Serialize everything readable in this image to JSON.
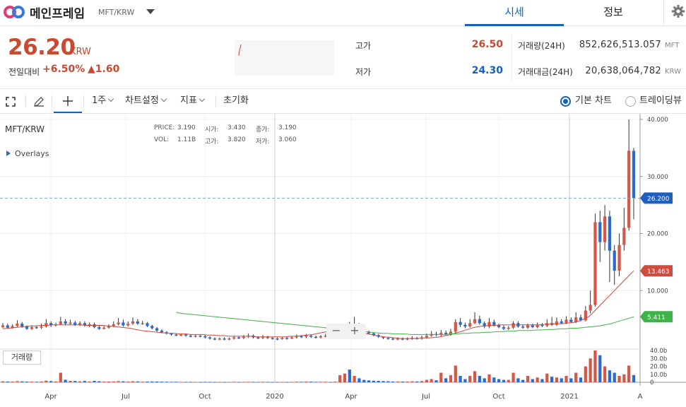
{
  "header": {
    "coin_name": "메인프레임",
    "coin_pair": "MFT/KRW",
    "tabs": [
      {
        "label": "시세",
        "active": true
      },
      {
        "label": "정보",
        "active": false
      }
    ]
  },
  "summary": {
    "price": "26.20",
    "unit": "KRW",
    "change_label": "전일대비",
    "change_pct": "+6.50%",
    "change_abs": "▲1.60",
    "high_label": "고가",
    "high_value": "26.50",
    "low_label": "저가",
    "low_value": "24.30",
    "volume_label": "거래량(24H)",
    "volume_value": "852,626,513.057",
    "volume_unit": "MFT",
    "amount_label": "거래대금(24H)",
    "amount_value": "20,638,064,782",
    "amount_unit": "KRW",
    "colors": {
      "up": "#c84a31",
      "down": "#1261c4"
    }
  },
  "toolbar": {
    "interval": "1주",
    "chart_settings": "차트설정",
    "indicators": "지표",
    "reset": "초기화",
    "basic_chart": "기본 차트",
    "tradingview": "트레이딩뷰"
  },
  "chart": {
    "pair_label": "MFT/KRW",
    "overlays_label": "Overlays",
    "ohlc": {
      "price_label": "PRICE:",
      "price": "3.190",
      "open_label": "시가:",
      "open": "3.430",
      "close_label": "종가:",
      "close": "3.190",
      "vol_label": "VOL:",
      "vol": "1.11B",
      "high_label": "고가:",
      "high": "3.820",
      "low_label": "저가:",
      "low": "3.060"
    },
    "volume_button": "거래량",
    "zoom_out": "−",
    "zoom_in": "+",
    "last_price_tag": "26.200",
    "ma1_tag": "13.463",
    "ma2_tag": "5.411"
  },
  "chart_data": {
    "type": "candlestick",
    "price_axis": {
      "min": 0,
      "max": 40,
      "ticks": [
        "40.000",
        "30.000",
        "20.000",
        "10.000"
      ]
    },
    "volume_axis": {
      "ticks": [
        "40.0b",
        "30.0b",
        "20.0b",
        "10.0b",
        "0"
      ]
    },
    "x_labels": [
      "Apr",
      "Jul",
      "Oct",
      "2020",
      "Apr",
      "Jul",
      "Oct",
      "2021",
      "A"
    ],
    "candles": [
      {
        "o": 3.6,
        "c": 3.9,
        "h": 4.3,
        "l": 3.4,
        "v": 1.2
      },
      {
        "o": 3.9,
        "c": 3.5,
        "h": 4.2,
        "l": 3.3,
        "v": 1.0
      },
      {
        "o": 3.5,
        "c": 3.8,
        "h": 4.1,
        "l": 3.3,
        "v": 0.9
      },
      {
        "o": 3.8,
        "c": 4.2,
        "h": 4.8,
        "l": 3.6,
        "v": 1.4
      },
      {
        "o": 4.2,
        "c": 3.7,
        "h": 4.5,
        "l": 3.5,
        "v": 1.1
      },
      {
        "o": 3.7,
        "c": 3.3,
        "h": 3.9,
        "l": 3.1,
        "v": 0.8
      },
      {
        "o": 3.3,
        "c": 3.6,
        "h": 3.9,
        "l": 3.1,
        "v": 0.8
      },
      {
        "o": 3.6,
        "c": 3.5,
        "h": 3.9,
        "l": 3.3,
        "v": 0.7
      },
      {
        "o": 3.5,
        "c": 3.7,
        "h": 4.2,
        "l": 3.3,
        "v": 0.9
      },
      {
        "o": 3.7,
        "c": 4.3,
        "h": 5.0,
        "l": 3.5,
        "v": 2.0
      },
      {
        "o": 4.3,
        "c": 3.9,
        "h": 4.6,
        "l": 3.6,
        "v": 1.5
      },
      {
        "o": 3.9,
        "c": 4.1,
        "h": 4.4,
        "l": 3.7,
        "v": 1.1
      },
      {
        "o": 4.1,
        "c": 4.6,
        "h": 5.4,
        "l": 3.9,
        "v": 12.0
      },
      {
        "o": 4.6,
        "c": 4.2,
        "h": 5.0,
        "l": 3.9,
        "v": 3.2
      },
      {
        "o": 4.2,
        "c": 4.4,
        "h": 4.9,
        "l": 4.0,
        "v": 1.8
      },
      {
        "o": 4.4,
        "c": 4.0,
        "h": 4.7,
        "l": 3.8,
        "v": 1.6
      },
      {
        "o": 4.0,
        "c": 4.3,
        "h": 4.6,
        "l": 3.8,
        "v": 1.2
      },
      {
        "o": 4.3,
        "c": 3.9,
        "h": 4.6,
        "l": 3.7,
        "v": 1.7
      },
      {
        "o": 3.9,
        "c": 4.1,
        "h": 4.4,
        "l": 3.6,
        "v": 1.0
      },
      {
        "o": 4.1,
        "c": 3.6,
        "h": 4.4,
        "l": 3.4,
        "v": 1.8
      },
      {
        "o": 3.6,
        "c": 3.3,
        "h": 3.9,
        "l": 3.1,
        "v": 1.3
      },
      {
        "o": 3.3,
        "c": 3.5,
        "h": 3.8,
        "l": 3.2,
        "v": 0.8
      },
      {
        "o": 3.5,
        "c": 3.8,
        "h": 4.1,
        "l": 3.3,
        "v": 0.9
      },
      {
        "o": 3.8,
        "c": 4.1,
        "h": 4.6,
        "l": 3.6,
        "v": 1.0
      },
      {
        "o": 4.1,
        "c": 4.4,
        "h": 5.2,
        "l": 3.9,
        "v": 1.4
      },
      {
        "o": 4.4,
        "c": 3.9,
        "h": 4.9,
        "l": 3.7,
        "v": 1.2
      },
      {
        "o": 3.9,
        "c": 4.2,
        "h": 4.6,
        "l": 3.7,
        "v": 0.9
      },
      {
        "o": 4.2,
        "c": 4.6,
        "h": 5.3,
        "l": 4.0,
        "v": 1.3
      },
      {
        "o": 4.6,
        "c": 4.2,
        "h": 5.0,
        "l": 4.0,
        "v": 1.1
      },
      {
        "o": 4.2,
        "c": 4.3,
        "h": 4.7,
        "l": 4.0,
        "v": 0.8
      },
      {
        "o": 4.3,
        "c": 3.8,
        "h": 4.5,
        "l": 3.6,
        "v": 0.9
      },
      {
        "o": 3.8,
        "c": 3.4,
        "h": 4.0,
        "l": 3.2,
        "v": 1.0
      },
      {
        "o": 3.4,
        "c": 3.0,
        "h": 3.6,
        "l": 2.8,
        "v": 0.9
      },
      {
        "o": 3.0,
        "c": 2.7,
        "h": 3.2,
        "l": 2.5,
        "v": 0.8
      },
      {
        "o": 2.7,
        "c": 2.5,
        "h": 2.9,
        "l": 2.3,
        "v": 0.7
      },
      {
        "o": 2.5,
        "c": 2.3,
        "h": 2.6,
        "l": 2.1,
        "v": 0.6
      },
      {
        "o": 2.3,
        "c": 2.2,
        "h": 2.5,
        "l": 2.0,
        "v": 0.6
      },
      {
        "o": 2.2,
        "c": 2.3,
        "h": 2.5,
        "l": 2.0,
        "v": 0.5
      },
      {
        "o": 2.3,
        "c": 2.1,
        "h": 2.5,
        "l": 1.9,
        "v": 0.5
      },
      {
        "o": 2.1,
        "c": 2.0,
        "h": 2.3,
        "l": 1.8,
        "v": 0.5
      },
      {
        "o": 2.0,
        "c": 2.1,
        "h": 2.3,
        "l": 1.8,
        "v": 0.4
      },
      {
        "o": 2.1,
        "c": 2.0,
        "h": 2.2,
        "l": 1.8,
        "v": 0.4
      },
      {
        "o": 2.0,
        "c": 1.8,
        "h": 2.2,
        "l": 1.6,
        "v": 0.5
      },
      {
        "o": 1.8,
        "c": 1.6,
        "h": 2.0,
        "l": 1.4,
        "v": 0.5
      },
      {
        "o": 1.6,
        "c": 1.5,
        "h": 1.8,
        "l": 1.3,
        "v": 0.4
      },
      {
        "o": 1.5,
        "c": 1.6,
        "h": 1.8,
        "l": 1.3,
        "v": 0.4
      },
      {
        "o": 1.6,
        "c": 1.5,
        "h": 1.8,
        "l": 1.3,
        "v": 0.3
      },
      {
        "o": 1.5,
        "c": 1.6,
        "h": 1.8,
        "l": 1.3,
        "v": 0.3
      },
      {
        "o": 1.6,
        "c": 1.8,
        "h": 2.1,
        "l": 1.4,
        "v": 0.6
      },
      {
        "o": 1.8,
        "c": 1.7,
        "h": 2.0,
        "l": 1.5,
        "v": 0.4
      },
      {
        "o": 1.7,
        "c": 1.9,
        "h": 2.2,
        "l": 1.5,
        "v": 0.5
      },
      {
        "o": 1.9,
        "c": 2.1,
        "h": 2.5,
        "l": 1.7,
        "v": 0.6
      },
      {
        "o": 2.1,
        "c": 1.8,
        "h": 2.3,
        "l": 1.6,
        "v": 0.5
      },
      {
        "o": 1.8,
        "c": 1.7,
        "h": 2.0,
        "l": 1.5,
        "v": 0.4
      },
      {
        "o": 1.7,
        "c": 1.9,
        "h": 2.2,
        "l": 1.5,
        "v": 0.6
      },
      {
        "o": 1.9,
        "c": 1.7,
        "h": 2.1,
        "l": 1.5,
        "v": 0.5
      },
      {
        "o": 1.7,
        "c": 1.6,
        "h": 1.9,
        "l": 1.4,
        "v": 0.4
      },
      {
        "o": 1.6,
        "c": 1.5,
        "h": 1.8,
        "l": 1.3,
        "v": 0.3
      },
      {
        "o": 1.5,
        "c": 1.7,
        "h": 1.9,
        "l": 1.4,
        "v": 0.4
      },
      {
        "o": 1.7,
        "c": 1.6,
        "h": 1.9,
        "l": 1.4,
        "v": 0.3
      },
      {
        "o": 1.6,
        "c": 1.8,
        "h": 2.0,
        "l": 1.5,
        "v": 0.5
      },
      {
        "o": 1.8,
        "c": 2.0,
        "h": 2.3,
        "l": 1.6,
        "v": 0.7
      },
      {
        "o": 2.0,
        "c": 1.9,
        "h": 2.2,
        "l": 1.7,
        "v": 0.6
      },
      {
        "o": 1.9,
        "c": 2.1,
        "h": 2.4,
        "l": 1.7,
        "v": 0.9
      },
      {
        "o": 2.1,
        "c": 1.9,
        "h": 2.3,
        "l": 1.7,
        "v": 0.8
      },
      {
        "o": 1.9,
        "c": 1.8,
        "h": 2.1,
        "l": 1.6,
        "v": 0.5
      },
      {
        "o": 1.8,
        "c": 2.0,
        "h": 2.2,
        "l": 1.6,
        "v": 0.6
      },
      {
        "o": 2.0,
        "c": 2.1,
        "h": 2.4,
        "l": 1.8,
        "v": 0.7
      },
      {
        "o": 2.1,
        "c": 1.8,
        "h": 2.3,
        "l": 1.6,
        "v": 0.5
      },
      {
        "o": 1.8,
        "c": 2.2,
        "h": 2.5,
        "l": 1.6,
        "v": 0.8
      },
      {
        "o": 2.2,
        "c": 2.8,
        "h": 3.2,
        "l": 2.0,
        "v": 9.0
      },
      {
        "o": 2.8,
        "c": 3.4,
        "h": 4.2,
        "l": 2.6,
        "v": 11.0
      },
      {
        "o": 3.4,
        "c": 3.0,
        "h": 4.5,
        "l": 2.8,
        "v": 16.0
      },
      {
        "o": 3.0,
        "c": 3.6,
        "h": 5.4,
        "l": 2.8,
        "v": 8.0
      },
      {
        "o": 3.6,
        "c": 3.1,
        "h": 4.3,
        "l": 2.9,
        "v": 5.0
      },
      {
        "o": 3.1,
        "c": 2.8,
        "h": 3.3,
        "l": 2.6,
        "v": 3.0
      },
      {
        "o": 2.8,
        "c": 2.5,
        "h": 3.0,
        "l": 2.3,
        "v": 2.4
      },
      {
        "o": 2.5,
        "c": 2.2,
        "h": 2.6,
        "l": 2.0,
        "v": 2.0
      },
      {
        "o": 2.2,
        "c": 1.9,
        "h": 2.4,
        "l": 1.7,
        "v": 1.8
      },
      {
        "o": 1.9,
        "c": 1.7,
        "h": 2.0,
        "l": 1.5,
        "v": 1.5
      },
      {
        "o": 1.7,
        "c": 1.6,
        "h": 1.9,
        "l": 1.4,
        "v": 1.3
      },
      {
        "o": 1.6,
        "c": 1.5,
        "h": 1.8,
        "l": 1.3,
        "v": 1.0
      },
      {
        "o": 1.5,
        "c": 1.6,
        "h": 1.8,
        "l": 1.3,
        "v": 1.0
      },
      {
        "o": 1.6,
        "c": 1.5,
        "h": 1.8,
        "l": 1.3,
        "v": 0.9
      },
      {
        "o": 1.5,
        "c": 1.6,
        "h": 1.8,
        "l": 1.3,
        "v": 0.9
      },
      {
        "o": 1.6,
        "c": 1.7,
        "h": 2.0,
        "l": 1.4,
        "v": 1.2
      },
      {
        "o": 1.7,
        "c": 1.6,
        "h": 1.9,
        "l": 1.4,
        "v": 1.0
      },
      {
        "o": 1.6,
        "c": 1.8,
        "h": 2.1,
        "l": 1.4,
        "v": 1.5
      },
      {
        "o": 1.8,
        "c": 2.1,
        "h": 2.5,
        "l": 1.6,
        "v": 3.0
      },
      {
        "o": 2.1,
        "c": 2.4,
        "h": 2.9,
        "l": 1.9,
        "v": 4.0
      },
      {
        "o": 2.4,
        "c": 2.2,
        "h": 2.8,
        "l": 2.0,
        "v": 2.5
      },
      {
        "o": 2.2,
        "c": 2.6,
        "h": 3.1,
        "l": 2.0,
        "v": 12.0
      },
      {
        "o": 2.6,
        "c": 2.3,
        "h": 3.0,
        "l": 2.1,
        "v": 5.0
      },
      {
        "o": 2.3,
        "c": 2.8,
        "h": 3.3,
        "l": 2.1,
        "v": 9.0
      },
      {
        "o": 2.8,
        "c": 4.5,
        "h": 5.0,
        "l": 2.6,
        "v": 21.0
      },
      {
        "o": 4.5,
        "c": 4.0,
        "h": 5.2,
        "l": 3.6,
        "v": 8.0
      },
      {
        "o": 4.0,
        "c": 3.7,
        "h": 4.4,
        "l": 3.4,
        "v": 4.0
      },
      {
        "o": 3.7,
        "c": 4.3,
        "h": 5.0,
        "l": 3.5,
        "v": 8.0
      },
      {
        "o": 4.3,
        "c": 5.0,
        "h": 6.2,
        "l": 4.1,
        "v": 14.0
      },
      {
        "o": 5.0,
        "c": 4.3,
        "h": 5.6,
        "l": 4.0,
        "v": 8.0
      },
      {
        "o": 4.3,
        "c": 3.7,
        "h": 4.6,
        "l": 3.4,
        "v": 5.0
      },
      {
        "o": 3.7,
        "c": 4.5,
        "h": 5.2,
        "l": 3.4,
        "v": 10.0
      },
      {
        "o": 4.5,
        "c": 3.9,
        "h": 4.9,
        "l": 3.7,
        "v": 6.0
      },
      {
        "o": 3.9,
        "c": 3.6,
        "h": 4.2,
        "l": 3.4,
        "v": 4.0
      },
      {
        "o": 3.6,
        "c": 3.3,
        "h": 3.9,
        "l": 3.1,
        "v": 3.0
      },
      {
        "o": 3.3,
        "c": 3.5,
        "h": 3.8,
        "l": 3.1,
        "v": 3.0
      },
      {
        "o": 3.5,
        "c": 4.3,
        "h": 4.6,
        "l": 3.3,
        "v": 12.0
      },
      {
        "o": 4.3,
        "c": 3.7,
        "h": 4.6,
        "l": 3.5,
        "v": 5.0
      },
      {
        "o": 3.7,
        "c": 3.5,
        "h": 4.0,
        "l": 3.3,
        "v": 3.0
      },
      {
        "o": 3.5,
        "c": 3.9,
        "h": 4.2,
        "l": 3.3,
        "v": 8.0
      },
      {
        "o": 3.9,
        "c": 3.6,
        "h": 4.2,
        "l": 3.4,
        "v": 4.0
      },
      {
        "o": 3.6,
        "c": 4.0,
        "h": 4.4,
        "l": 3.4,
        "v": 6.0
      },
      {
        "o": 4.0,
        "c": 3.8,
        "h": 4.3,
        "l": 3.6,
        "v": 4.0
      },
      {
        "o": 3.8,
        "c": 4.3,
        "h": 5.0,
        "l": 3.6,
        "v": 11.0
      },
      {
        "o": 4.3,
        "c": 4.0,
        "h": 5.4,
        "l": 3.8,
        "v": 7.0
      },
      {
        "o": 4.0,
        "c": 4.6,
        "h": 5.3,
        "l": 3.8,
        "v": 6.0
      },
      {
        "o": 4.6,
        "c": 4.3,
        "h": 5.0,
        "l": 4.1,
        "v": 5.0
      },
      {
        "o": 4.3,
        "c": 4.9,
        "h": 5.5,
        "l": 4.1,
        "v": 8.0
      },
      {
        "o": 4.9,
        "c": 4.5,
        "h": 5.3,
        "l": 4.3,
        "v": 5.0
      },
      {
        "o": 4.5,
        "c": 5.3,
        "h": 6.2,
        "l": 4.3,
        "v": 12.0
      },
      {
        "o": 5.3,
        "c": 4.8,
        "h": 5.8,
        "l": 4.6,
        "v": 6.0
      },
      {
        "o": 4.8,
        "c": 6.5,
        "h": 7.3,
        "l": 4.6,
        "v": 20.0
      },
      {
        "o": 6.5,
        "c": 7.5,
        "h": 10.0,
        "l": 6.0,
        "v": 30.0
      },
      {
        "o": 7.5,
        "c": 22.0,
        "h": 23.5,
        "l": 7.2,
        "v": 40.0
      },
      {
        "o": 22.0,
        "c": 18.5,
        "h": 24.0,
        "l": 15.0,
        "v": 34.0
      },
      {
        "o": 18.5,
        "c": 23.0,
        "h": 25.0,
        "l": 17.0,
        "v": 20.0
      },
      {
        "o": 23.0,
        "c": 17.0,
        "h": 24.0,
        "l": 11.5,
        "v": 15.0
      },
      {
        "o": 17.0,
        "c": 13.5,
        "h": 18.0,
        "l": 11.0,
        "v": 12.0
      },
      {
        "o": 13.5,
        "c": 18.0,
        "h": 20.0,
        "l": 12.5,
        "v": 8.0
      },
      {
        "o": 18.0,
        "c": 21.0,
        "h": 24.5,
        "l": 17.0,
        "v": 10.0
      },
      {
        "o": 21.0,
        "c": 34.5,
        "h": 40.0,
        "l": 20.5,
        "v": 21.0
      },
      {
        "o": 34.5,
        "c": 26.2,
        "h": 35.0,
        "l": 22.5,
        "v": 9.0
      }
    ],
    "ma1": [
      3.3,
      3.4,
      3.5,
      3.6,
      3.7,
      3.8,
      3.8,
      3.9,
      3.9,
      4.0,
      4.0,
      4.0,
      4.0,
      4.0,
      4.0,
      3.9,
      3.9,
      3.9,
      3.9,
      3.8,
      3.7,
      3.6,
      3.5,
      3.4,
      3.2,
      3.0,
      2.9,
      2.8,
      2.7,
      2.6,
      2.5,
      2.5,
      2.4,
      2.4,
      2.3,
      2.3,
      2.3,
      2.2,
      2.2,
      2.1,
      2.1,
      2.0,
      2.0,
      2.0,
      2.0,
      2.0,
      1.9,
      1.9,
      1.9,
      1.9,
      1.9,
      1.9,
      2.0,
      2.0,
      2.1,
      2.2,
      2.3,
      2.5,
      2.7,
      2.9,
      3.0,
      3.0,
      3.0,
      2.9,
      2.8,
      2.6,
      2.4,
      2.2,
      2.0,
      1.9,
      1.8,
      1.7,
      1.6,
      1.6,
      1.6,
      1.6,
      1.7,
      1.7,
      1.8,
      1.9,
      2.1,
      2.3,
      2.6,
      2.9,
      3.2,
      3.5,
      3.7,
      3.8,
      3.9,
      3.9,
      4.0,
      4.0,
      4.0,
      4.0,
      4.0,
      4.0,
      4.0,
      4.0,
      4.1,
      4.1,
      4.2,
      4.2,
      4.3,
      4.4,
      4.6,
      5.0,
      5.5,
      6.5,
      7.5,
      8.5,
      9.5,
      10.5,
      11.5,
      12.5,
      13.46
    ],
    "ma2": [
      6.2,
      6.0,
      5.9,
      5.8,
      5.7,
      5.6,
      5.5,
      5.4,
      5.3,
      5.2,
      5.1,
      5.0,
      4.9,
      4.8,
      4.7,
      4.6,
      4.5,
      4.4,
      4.3,
      4.2,
      4.1,
      4.0,
      3.9,
      3.8,
      3.7,
      3.6,
      3.5,
      3.4,
      3.3,
      3.2,
      3.1,
      3.0,
      2.9,
      2.8,
      2.7,
      2.6,
      2.5,
      2.5,
      2.4,
      2.4,
      2.4,
      2.3,
      2.3,
      2.3,
      2.3,
      2.3,
      2.3,
      2.3,
      2.4,
      2.4,
      2.5,
      2.5,
      2.6,
      2.6,
      2.7,
      2.7,
      2.8,
      2.8,
      2.9,
      2.9,
      3.0,
      3.0,
      3.0,
      3.1,
      3.1,
      3.2,
      3.2,
      3.3,
      3.3,
      3.4,
      3.4,
      3.5,
      3.6,
      3.7,
      3.8,
      4.0,
      4.2,
      4.5,
      4.8,
      5.1,
      5.41
    ]
  }
}
